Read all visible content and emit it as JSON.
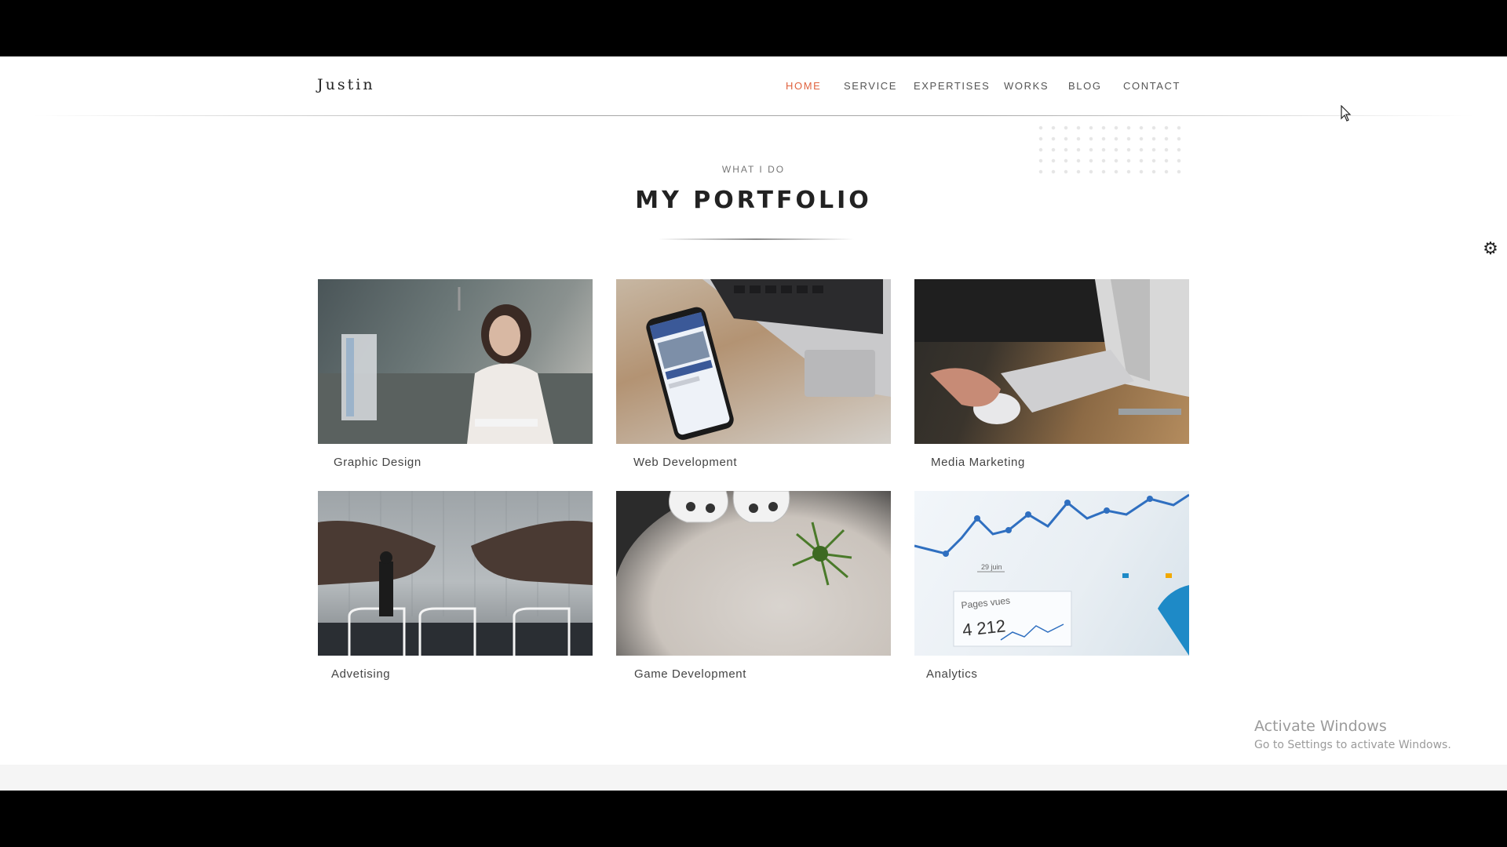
{
  "brand": "Justin",
  "nav": {
    "items": [
      {
        "label": "HOME",
        "active": true
      },
      {
        "label": "SERVICE",
        "active": false
      },
      {
        "label": "EXPERTISES",
        "active": false
      },
      {
        "label": "WORKS",
        "active": false
      },
      {
        "label": "BLOG",
        "active": false
      },
      {
        "label": "CONTACT",
        "active": false
      }
    ]
  },
  "section": {
    "eyebrow": "WHAT I DO",
    "title": "MY PORTFOLIO"
  },
  "portfolio": {
    "items": [
      {
        "label": "Graphic Design"
      },
      {
        "label": "Web Development"
      },
      {
        "label": "Media Marketing"
      },
      {
        "label": "Advetising"
      },
      {
        "label": "Game Development"
      },
      {
        "label": "Analytics"
      }
    ]
  },
  "thumbnail_texts": {
    "pages_vues": "Pages vues",
    "pages_count": "4 212",
    "date_label": "29 juin"
  },
  "windows_watermark": {
    "title": "Activate Windows",
    "subtitle": "Go to Settings to activate Windows."
  },
  "colors": {
    "accent": "#e0633f",
    "text": "#222222",
    "nav_text": "#555555"
  },
  "icons": {
    "settings": "gear-icon",
    "cursor": "mouse-cursor-icon"
  }
}
